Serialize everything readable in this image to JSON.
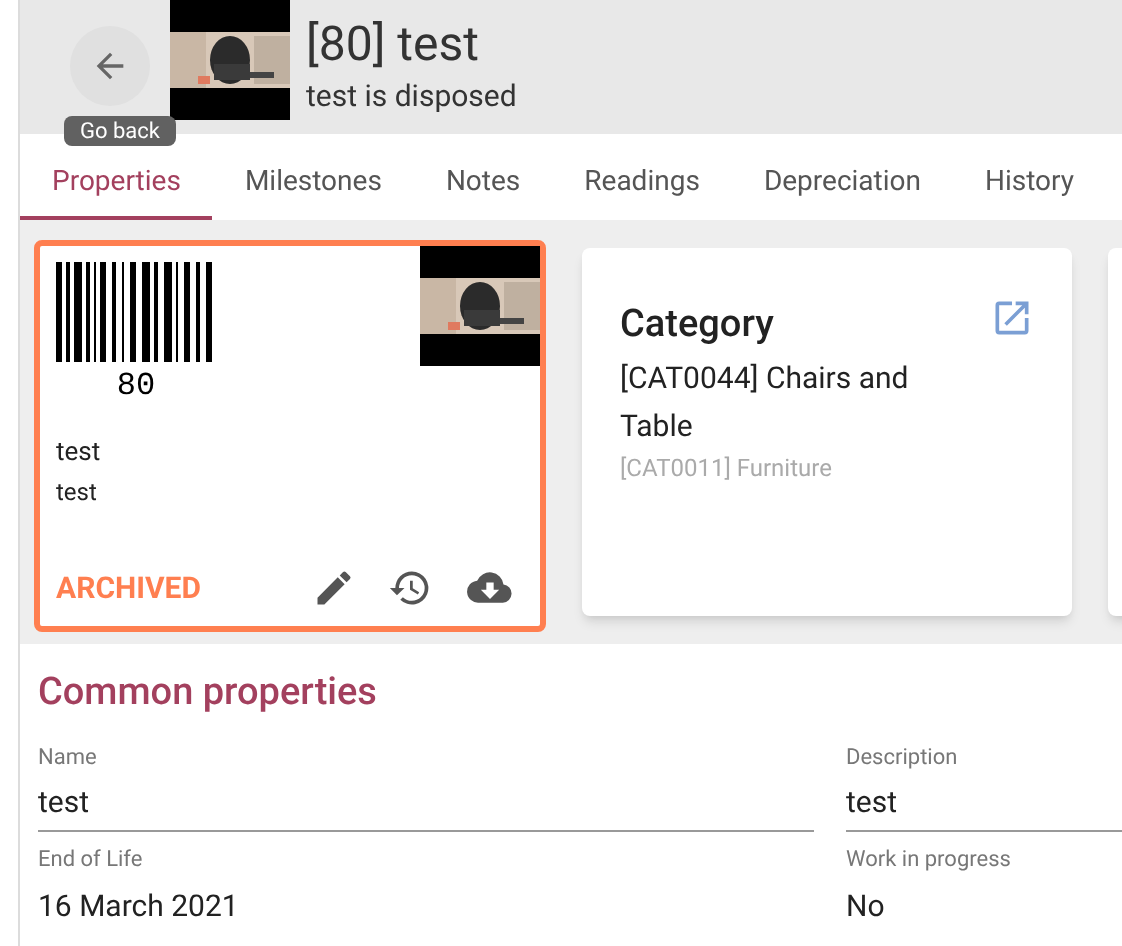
{
  "header": {
    "title": "[80] test",
    "subtitle": "test is disposed",
    "back_tooltip": "Go back"
  },
  "tabs": [
    {
      "label": "Properties",
      "selected": true
    },
    {
      "label": "Milestones",
      "selected": false
    },
    {
      "label": "Notes",
      "selected": false
    },
    {
      "label": "Readings",
      "selected": false
    },
    {
      "label": "Depreciation",
      "selected": false
    },
    {
      "label": "History",
      "selected": false
    }
  ],
  "asset_card": {
    "barcode_number": "80",
    "name": "test",
    "description": "test",
    "status": "ARCHIVED"
  },
  "category_card": {
    "title": "Category",
    "category": "[CAT0044] Chairs and Table",
    "parent": "[CAT0011] Furniture"
  },
  "common_properties": {
    "title": "Common properties",
    "fields": [
      {
        "label": "Name",
        "value": "test"
      },
      {
        "label": "Description",
        "value": "test"
      },
      {
        "label": "End of Life",
        "value": "16 March 2021"
      },
      {
        "label": "Work in progress",
        "value": "No"
      }
    ]
  }
}
